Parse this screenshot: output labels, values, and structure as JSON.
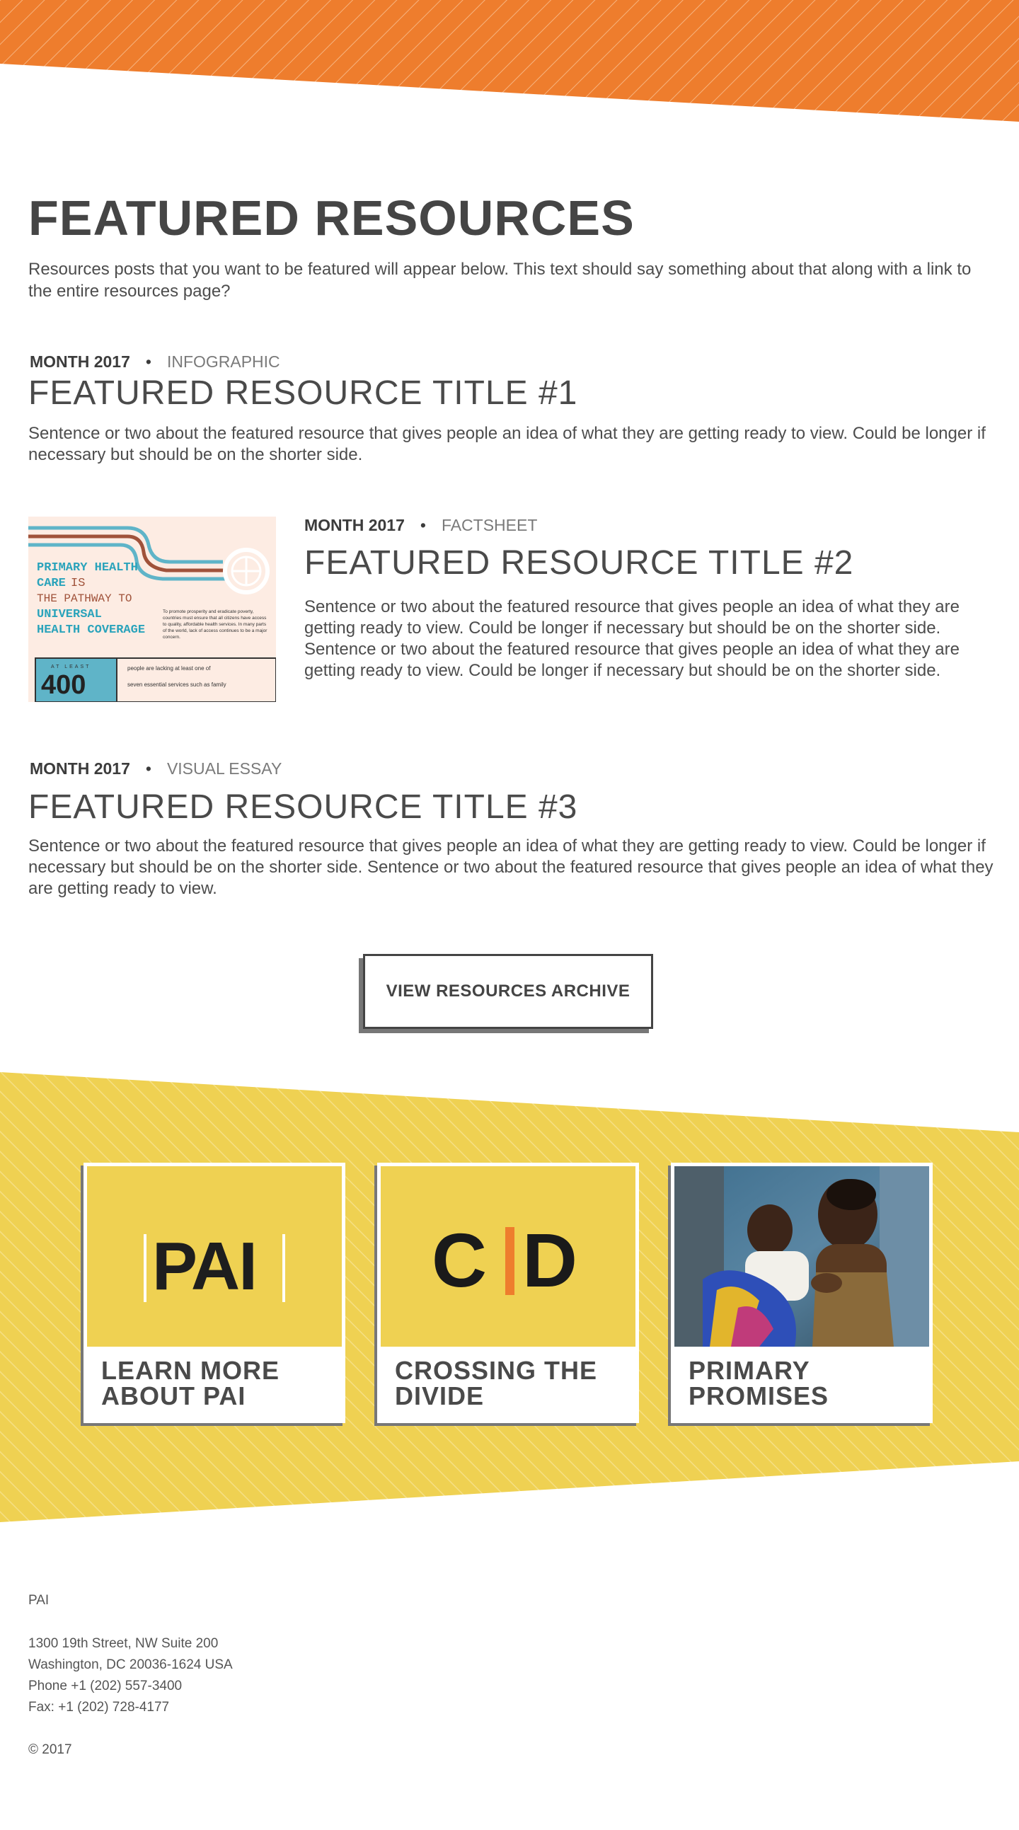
{
  "header": {
    "title": "FEATURED RESOURCES",
    "intro": "Resources posts that you want to be featured will appear below. This text should say something about that along with a link to the entire resources page?"
  },
  "resources": [
    {
      "date": "MONTH 2017",
      "type": "INFOGRAPHIC",
      "title": "FEATURED RESOURCE TITLE #1",
      "text": "Sentence or two about the featured resource that gives people an idea of what they are getting ready to view. Could be longer if necessary but should be on the shorter side."
    },
    {
      "date": "MONTH 2017",
      "type": "FACTSHEET",
      "title": "FEATURED RESOURCE TITLE #2",
      "text": "Sentence or two about the featured resource that gives people an idea of what they are getting ready to view. Could be longer if necessary but should be on the shorter side. Sentence or two about the featured resource that gives people an idea of what they are getting ready to view. Could be longer if necessary but should be on the shorter side.",
      "thumbnail": {
        "heading_1": "PRIMARY HEALTH",
        "heading_2": "CARE",
        "heading_3": "IS",
        "heading_4": "THE PATHWAY TO",
        "heading_5": "UNIVERSAL",
        "heading_6": "HEALTH COVERAGE",
        "body": "To promote prosperity and eradicate poverty, countries must ensure that all citizens have access to quality, affordable health services. In many parts of the world, lack of access continues to be a major concern.",
        "stat_label": "AT LEAST",
        "stat_value": "400",
        "stat_text_1": "people are lacking at least one of",
        "stat_text_2": "seven essential services such as family"
      }
    },
    {
      "date": "MONTH 2017",
      "type": "VISUAL ESSAY",
      "title": "FEATURED RESOURCE TITLE #3",
      "text": "Sentence or two about the featured resource that gives people an idea of what they are getting ready to view. Could be longer if necessary but should be on the shorter side. Sentence or two about the featured resource that gives people an idea of what they are getting ready to view."
    }
  ],
  "archive_button": "VIEW RESOURCES ARCHIVE",
  "cards": [
    {
      "logo": "PAI",
      "label": "LEARN MORE ABOUT PAI"
    },
    {
      "logo_left": "C",
      "logo_right": "D",
      "label": "CROSSING THE DIVIDE"
    },
    {
      "label": "PRIMARY PROMISES"
    }
  ],
  "footer": {
    "org": "PAI",
    "address_1": "1300 19th Street, NW Suite 200",
    "address_2": "Washington, DC 20036-1624 USA",
    "phone": "Phone +1 (202) 557-3400",
    "fax": "Fax: +1 (202) 728-4177",
    "copyright": "© 2017"
  },
  "colors": {
    "orange": "#ee7d2d",
    "yellow": "#efd152",
    "text": "#4a4a4a",
    "thumb_teal": "#2aa3bb",
    "thumb_brown": "#a0523a"
  }
}
